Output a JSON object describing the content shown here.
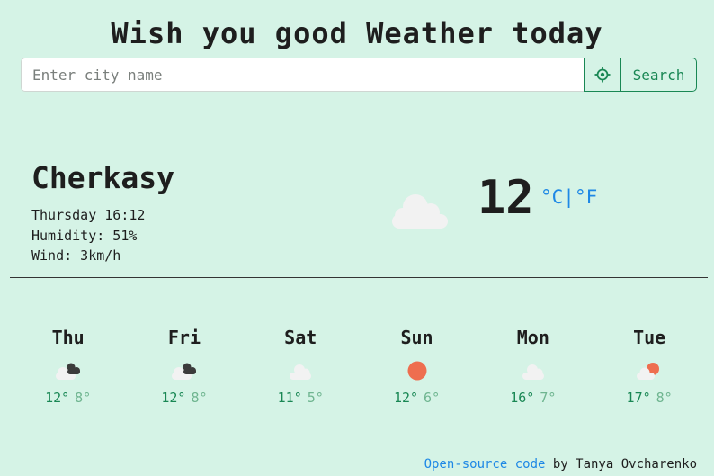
{
  "header": {
    "title": "Wish you good Weather today"
  },
  "search": {
    "placeholder": "Enter city name",
    "value": "",
    "button_label": "Search"
  },
  "current": {
    "city": "Cherkasy",
    "datetime": "Thursday 16:12",
    "humidity": "Humidity: 51%",
    "wind": "Wind: 3km/h",
    "temperature": "12",
    "unit_c": "°C",
    "unit_sep": "|",
    "unit_f": "°F",
    "icon": "cloud-icon"
  },
  "forecast": [
    {
      "day": "Thu",
      "max": "12°",
      "min": "8°",
      "icon": "broken-clouds-icon"
    },
    {
      "day": "Fri",
      "max": "12°",
      "min": "8°",
      "icon": "broken-clouds-icon"
    },
    {
      "day": "Sat",
      "max": "11°",
      "min": "5°",
      "icon": "cloud-icon"
    },
    {
      "day": "Sun",
      "max": "12°",
      "min": "6°",
      "icon": "sun-icon"
    },
    {
      "day": "Mon",
      "max": "16°",
      "min": "7°",
      "icon": "cloud-icon"
    },
    {
      "day": "Tue",
      "max": "17°",
      "min": "8°",
      "icon": "partly-cloudy-icon"
    }
  ],
  "footer": {
    "link_text": "Open-source code",
    "suffix": " by Tanya Ovcharenko"
  },
  "colors": {
    "background": "#d5f3e6",
    "accent": "#198754",
    "link": "#1e88e5",
    "sun": "#ee6e4f"
  }
}
